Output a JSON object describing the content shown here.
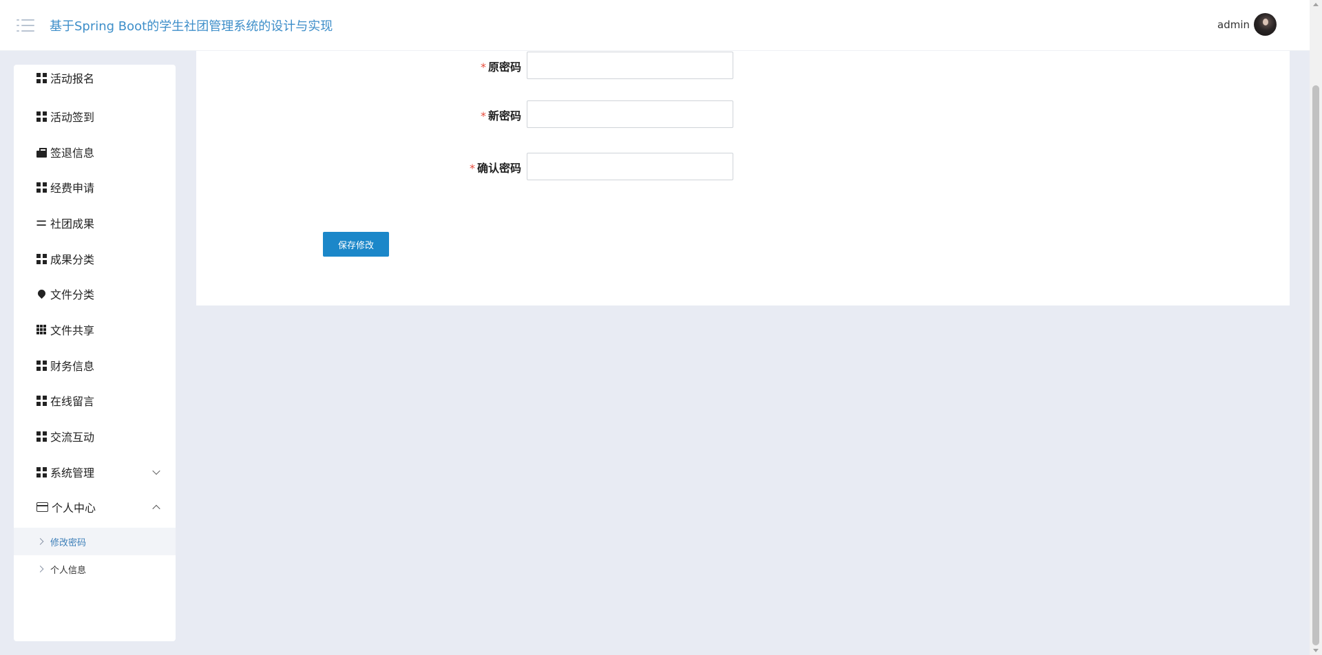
{
  "header": {
    "app_title": "基于Spring Boot的学生社团管理系统的设计与实现",
    "user_name": "admin",
    "menu_icon": "list-menu-icon"
  },
  "sidebar": {
    "items": [
      {
        "label": "活动报名",
        "icon": "grid-icon"
      },
      {
        "label": "活动签到",
        "icon": "grid-icon"
      },
      {
        "label": "签退信息",
        "icon": "briefcase-icon"
      },
      {
        "label": "经费申请",
        "icon": "grid-icon"
      },
      {
        "label": "社团成果",
        "icon": "sliders-icon"
      },
      {
        "label": "成果分类",
        "icon": "grid-icon"
      },
      {
        "label": "文件分类",
        "icon": "drop-icon"
      },
      {
        "label": "文件共享",
        "icon": "grid-nine-icon"
      },
      {
        "label": "财务信息",
        "icon": "grid-icon"
      },
      {
        "label": "在线留言",
        "icon": "grid-icon"
      },
      {
        "label": "交流互动",
        "icon": "grid-icon"
      },
      {
        "label": "系统管理",
        "icon": "grid-icon"
      },
      {
        "label": "个人中心",
        "icon": "wallet-icon"
      }
    ],
    "sub_items": [
      {
        "label": "修改密码",
        "active": true
      },
      {
        "label": "个人信息",
        "active": false
      }
    ]
  },
  "form": {
    "old_password_label": "原密码",
    "new_password_label": "新密码",
    "confirm_password_label": "确认密码",
    "required_mark": "*",
    "old_password_value": "",
    "new_password_value": "",
    "confirm_password_value": "",
    "save_label": "保存修改"
  },
  "colors": {
    "accent": "#3d8ec9",
    "button": "#1b87c9",
    "background": "#e8ebf3",
    "required": "#e74c3c"
  }
}
